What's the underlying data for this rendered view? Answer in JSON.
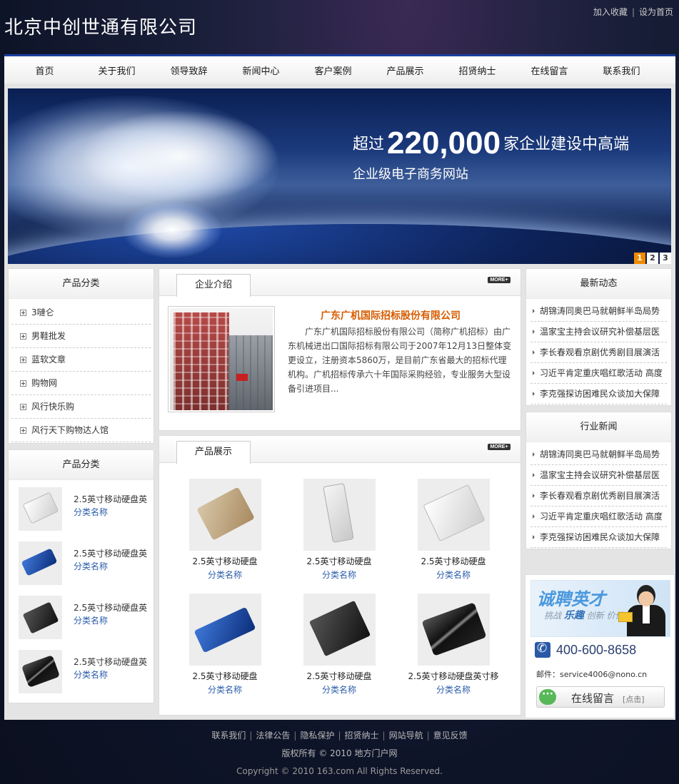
{
  "header": {
    "site_title": "北京中创世通有限公司",
    "links": [
      "加入收藏",
      "设为首页"
    ]
  },
  "nav": [
    "首页",
    "关于我们",
    "领导致辞",
    "新闻中心",
    "客户案例",
    "产品展示",
    "招贤纳士",
    "在线留言",
    "联系我们"
  ],
  "banner": {
    "line1_pre": "超过",
    "line1_num": "220,000",
    "line1_post": "家企业建设中高端",
    "line2": "企业级电子商务网站",
    "pages": [
      "1",
      "2",
      "3"
    ],
    "active_page": "1"
  },
  "left": {
    "categories_title": "产品分类",
    "categories": [
      "3嗹仑",
      "男鞋批发",
      "蓝软文章",
      "购物网",
      "风行快乐购",
      "风行天下购物达人馆"
    ],
    "products_title": "产品分类",
    "products": [
      {
        "name": "2.5英寸移动硬盘英",
        "category": "分类名称",
        "icon": "silver-drive"
      },
      {
        "name": "2.5英寸移动硬盘英",
        "category": "分类名称",
        "icon": "blue-usb-drive"
      },
      {
        "name": "2.5英寸移动硬盘英",
        "category": "分类名称",
        "icon": "black-drive"
      },
      {
        "name": "2.5英寸移动硬盘英",
        "category": "分类名称",
        "icon": "black-stripe-drive"
      }
    ]
  },
  "intro": {
    "tab": "企业介绍",
    "more": "MORE+",
    "company": "广东广机国际招标股份有限公司",
    "text": "广东广机国际招标股份有限公司（简称广机招标）由广东机械进出口国际招标有限公司于2007年12月13日整体变更设立，注册资本5860万，是目前广东省最大的招标代理机构。广机招标传承六十年国际采购经验，专业服务大型设备引进项目..."
  },
  "products_panel": {
    "tab": "产品展示",
    "more": "MORE+",
    "items": [
      {
        "name": "2.5英寸移动硬盘",
        "category": "分类名称",
        "icon": "gold-drive"
      },
      {
        "name": "2.5英寸移动硬盘",
        "category": "分类名称",
        "icon": "silver-usb-drive"
      },
      {
        "name": "2.5英寸移动硬盘",
        "category": "分类名称",
        "icon": "silver-drive"
      },
      {
        "name": "2.5英寸移动硬盘",
        "category": "分类名称",
        "icon": "blue-usb-drive"
      },
      {
        "name": "2.5英寸移动硬盘",
        "category": "分类名称",
        "icon": "black-drive"
      },
      {
        "name": "2.5英寸移动硬盘英寸移",
        "category": "分类名称",
        "icon": "black-stripe-drive"
      }
    ]
  },
  "right": {
    "latest_title": "最新动态",
    "latest": [
      "胡锦涛同奥巴马就朝鲜半岛局势",
      "温家宝主持会议研究补偿基层医",
      "李长春观看京剧优秀剧目展演活",
      "习近平肯定重庆唱红歌活动 高度",
      "李克强探访困难民众谈加大保障"
    ],
    "industry_title": "行业新闻",
    "industry": [
      "胡锦涛同奥巴马就朝鲜半岛局势",
      "温家宝主持会议研究补偿基层医",
      "李长春观看京剧优秀剧目展演活",
      "习近平肯定重庆唱红歌活动 高度",
      "李克强探访困难民众谈加大保障"
    ]
  },
  "contact": {
    "recruit_title": "诚聘英才",
    "recruit_words": [
      "创新",
      "价值",
      "挑战",
      "乐趣"
    ],
    "phone": "400-600-8658",
    "email": "邮件：service4006@nono.cn",
    "message_label": "在线留言",
    "message_sub": "[点击]"
  },
  "footer": {
    "links": [
      "联系我们",
      "法律公告",
      "隐私保护",
      "招贤纳士",
      "网站导航",
      "意见反馈"
    ],
    "rights": "版权所有 © 2010 地方门户网",
    "copyright": "Copyright © 2010 163.com All Rights Reserved."
  },
  "colors": {
    "nav_accent": "#1b3fa0",
    "intro_title": "#d65c00",
    "category_link": "#2a5caa",
    "pager_active": "#f08a00"
  }
}
